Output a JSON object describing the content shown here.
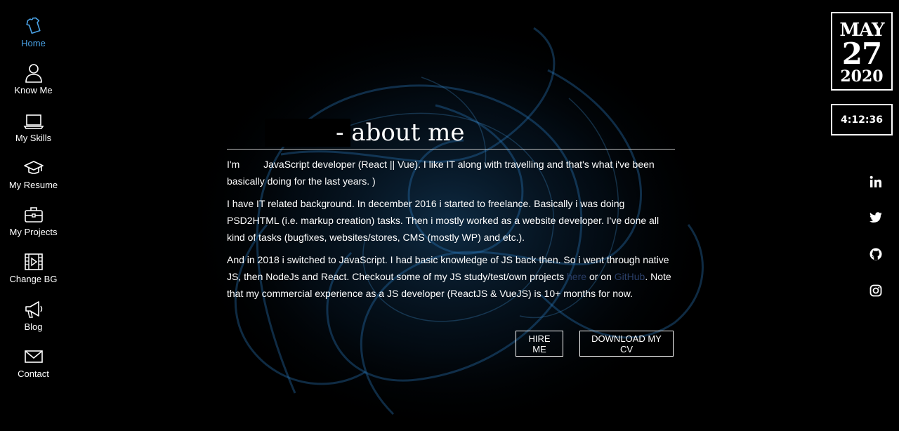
{
  "nav": {
    "items": [
      {
        "label": "Home",
        "icon": "shirt-icon",
        "active": true
      },
      {
        "label": "Know Me",
        "icon": "user-icon"
      },
      {
        "label": "My Skills",
        "icon": "laptop-icon"
      },
      {
        "label": "My Resume",
        "icon": "graduation-cap-icon"
      },
      {
        "label": "My Projects",
        "icon": "briefcase-icon"
      },
      {
        "label": "Change BG",
        "icon": "film-icon"
      },
      {
        "label": "Blog",
        "icon": "megaphone-icon"
      },
      {
        "label": "Contact",
        "icon": "envelope-icon"
      }
    ]
  },
  "date": {
    "month": "MAY",
    "day": "27",
    "year": "2020"
  },
  "clock": "4:12:36",
  "social": [
    "linkedin-icon",
    "twitter-icon",
    "github-icon",
    "instagram-icon"
  ],
  "main": {
    "heading": "- about me",
    "p1_a": "I'm",
    "p1_b": "JavaScript developer (React || Vue). I like IT along with travelling and that's what i've been basically doing for the last years. )",
    "p2": "I have IT related background. In december 2016 i started to freelance. Basically i was doing PSD2HTML (i.e. markup creation) tasks. Then i mostly worked as a website developer. I've done all kind of tasks (bugfixes, websites/stores, CMS (mostly WP) and etc.).",
    "p3_a": "And in 2018 i switched to JavaScript. I had basic knowledge of JS back then. So i went through native JS, then NodeJs and React. Checkout some of my JS study/test/own projects",
    "p3_link1": "here",
    "p3_b": "or on",
    "p3_link2": "GitHub",
    "p3_c": ".  Note that my commercial experience as a JS developer (ReactJS & VueJS) is 10+ months for now."
  },
  "buttons": {
    "hire": "HIRE ME",
    "cv": "DOWNLOAD MY CV"
  },
  "colors": {
    "accent": "#4aa2e6",
    "background": "#000000",
    "text": "#ffffff",
    "link": "#2a3e68"
  }
}
